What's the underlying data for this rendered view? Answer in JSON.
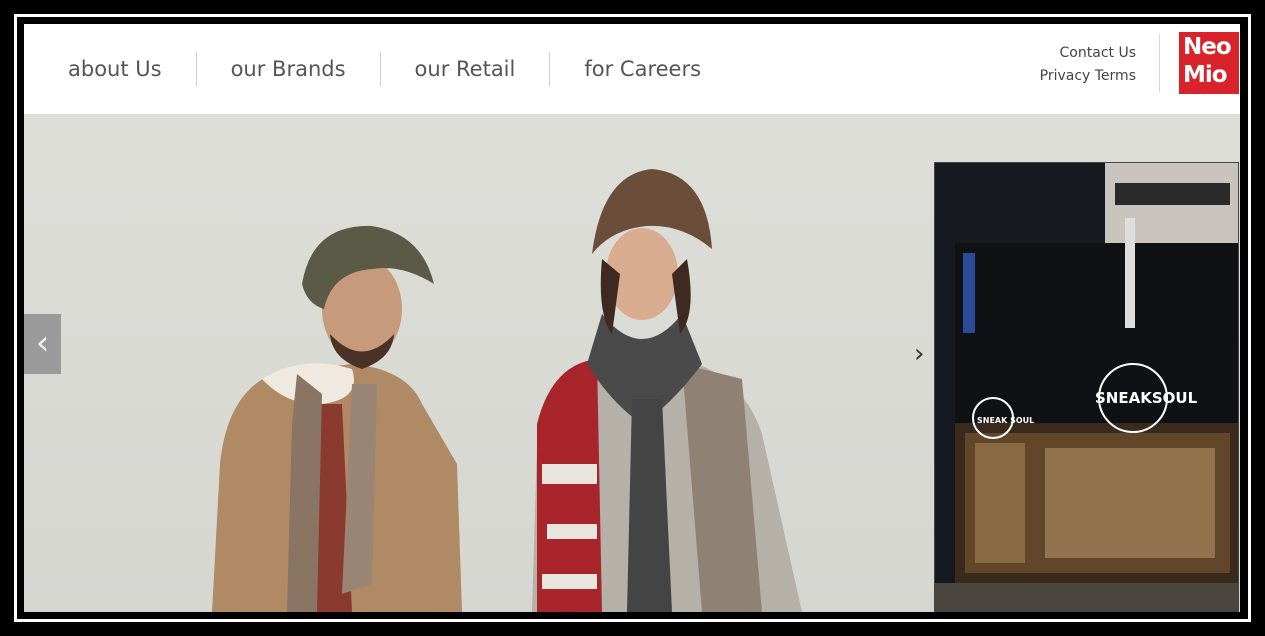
{
  "nav": {
    "items": [
      "about Us",
      "our Brands",
      "our Retail",
      "for Careers"
    ]
  },
  "util": {
    "contact": "Contact Us",
    "privacy": "Privacy Terms"
  },
  "logo": {
    "line1": "Neo",
    "line2": "Mio"
  },
  "slider": {
    "prev": "‹",
    "next": "›"
  },
  "thumbnail": {
    "store_sign": "SNEAKSOUL",
    "side_sign": "SNEAK SOUL"
  },
  "colors": {
    "brand": "#d8232a",
    "nav_text": "#555555"
  },
  "icons": {
    "prev": "chevron-left-icon",
    "next": "chevron-right-icon"
  }
}
